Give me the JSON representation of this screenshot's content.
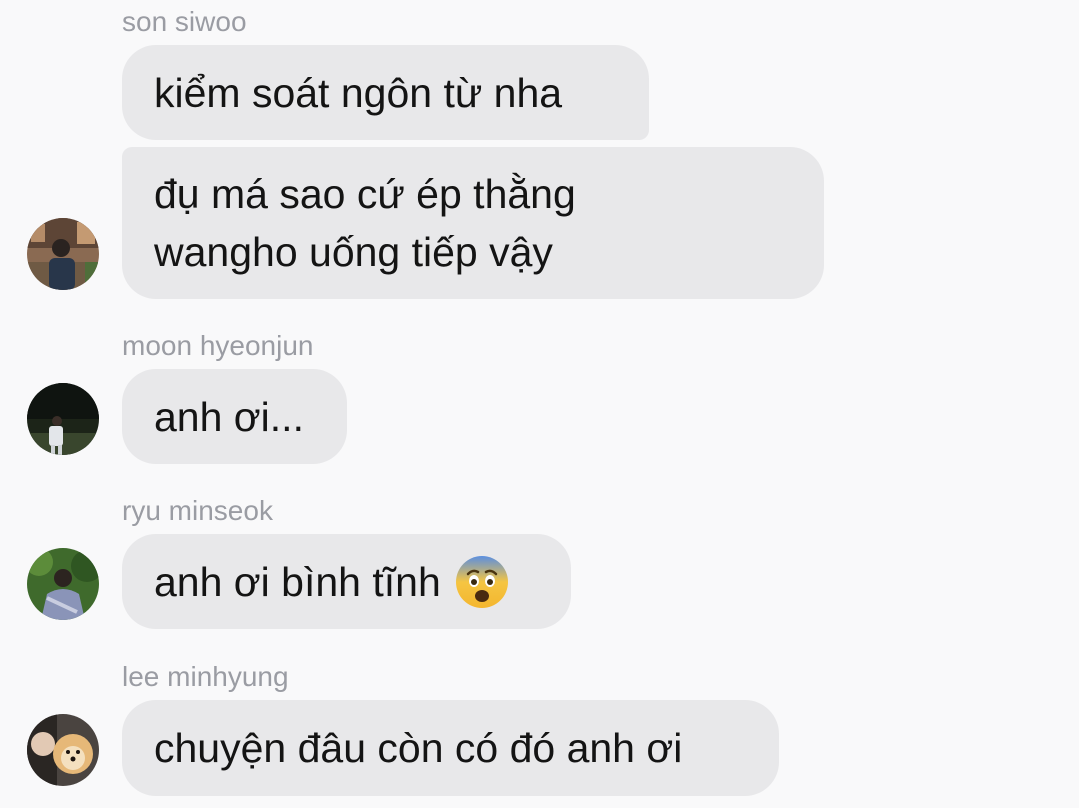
{
  "messages": [
    {
      "sender": "son siwoo",
      "bubbles": [
        {
          "lines": [
            "kiểm soát ngôn từ nha"
          ]
        },
        {
          "lines": [
            "đụ má sao cứ ép thằng",
            "wangho uống tiếp vậy"
          ]
        }
      ]
    },
    {
      "sender": "moon hyeonjun",
      "bubbles": [
        {
          "lines": [
            "anh ơi..."
          ]
        }
      ]
    },
    {
      "sender": "ryu minseok",
      "bubbles": [
        {
          "lines": [
            "anh ơi bình tĩnh"
          ],
          "emoji": "fearful-face"
        }
      ]
    },
    {
      "sender": "lee minhyung",
      "bubbles": [
        {
          "lines": [
            "chuyện đâu còn có đó anh ơi"
          ]
        }
      ]
    }
  ],
  "colors": {
    "background": "#f9f9fa",
    "bubble": "#e8e8ea",
    "sender_name": "#9a9ca3",
    "message_text": "#141414"
  }
}
